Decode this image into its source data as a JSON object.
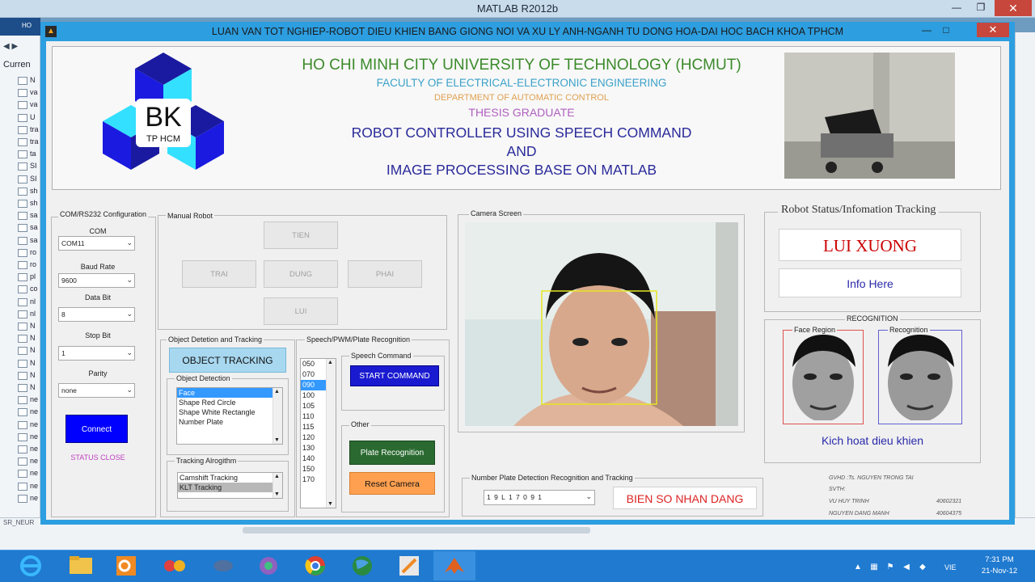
{
  "matlab": {
    "title": "MATLAB R2012b",
    "side_header": "HO",
    "side_current": "Curren",
    "side_items": [
      "N",
      "va",
      "va",
      "U",
      "tra",
      "tra",
      "ta",
      "SI",
      "SI",
      "sh",
      "sh",
      "sa",
      "sa",
      "sa",
      "ro",
      "ro",
      "pl",
      "co",
      "nl",
      "nl",
      "N",
      "N",
      "N",
      "N",
      "N",
      "N",
      "ne",
      "ne",
      "ne",
      "ne",
      "ne",
      "ne",
      "ne",
      "ne",
      "ne"
    ],
    "status": "SR_NEUR"
  },
  "gui": {
    "title": "LUAN VAN TOT NGHIEP-ROBOT DIEU KHIEN BANG GIONG NOI VA XU LY ANH-NGANH TU DONG HOA-DAI HOC BACH KHOA TPHCM",
    "window_controls": {
      "minimize": "—",
      "maximize": "□",
      "close": "✕"
    }
  },
  "header": {
    "logo_text": "BK",
    "logo_sub": "TP HCM",
    "university": "HO CHI MINH CITY UNIVERSITY OF TECHNOLOGY (HCMUT)",
    "faculty": "FACULTY OF ELECTRICAL-ELECTRONIC ENGINEERING",
    "department": "DEPARTMENT OF AUTOMATIC CONTROL",
    "thesis": "THESIS GRADUATE",
    "title_line1": "ROBOT CONTROLLER USING SPEECH COMMAND",
    "title_line2": "AND",
    "title_line3": "IMAGE PROCESSING BASE ON MATLAB"
  },
  "com_panel": {
    "title": "COM/RS232 Configuration",
    "com_label": "COM",
    "com_value": "COM11",
    "baud_label": "Baud Rate",
    "baud_value": "9600",
    "databit_label": "Data Bit",
    "databit_value": "8",
    "stopbit_label": "Stop Bit",
    "stopbit_value": "1",
    "parity_label": "Parity",
    "parity_value": "none",
    "connect_label": "Connect",
    "status": "STATUS CLOSE"
  },
  "manual_panel": {
    "title": "Manual Robot",
    "up": "TIEN",
    "left": "TRAI",
    "stop": "DUNG",
    "right": "PHAI",
    "down": "LUI"
  },
  "object_panel": {
    "title": "Object Detetion and Tracking",
    "tracking_button": "OBJECT TRACKING",
    "detection_title": "Object Detection",
    "detection_items": [
      "Face",
      "Shape Red Circle",
      "Shape White Rectangle",
      "Number Plate"
    ],
    "tracking_title": "Tracking Alrogithm",
    "tracking_items": [
      "Camshift Tracking",
      "KLT Tracking"
    ]
  },
  "speech_panel": {
    "title": "Speech/PWM/Plate Recognition",
    "pwm_items": [
      "050",
      "070",
      "090",
      "100",
      "105",
      "110",
      "115",
      "120",
      "130",
      "140",
      "150",
      "170"
    ],
    "speech_title": "Speech Command",
    "start_command": "START COMMAND",
    "other_title": "Other",
    "plate_button": "Plate Recognition",
    "reset_button": "Reset Camera"
  },
  "camera_panel": {
    "title": "Camera Screen"
  },
  "plate_panel": {
    "title": "Number Plate Detection Recognition and Tracking",
    "plate_value": "1 9 L 1 7 0 9 1",
    "plate_result": "BIEN SO NHAN DANG"
  },
  "status_panel": {
    "title": "Robot Status/Infomation Tracking",
    "status_text": "LUI XUONG",
    "info_text": "Info Here"
  },
  "recognition_panel": {
    "title": "RECOGNITION",
    "face_title": "Face Region",
    "recog_title": "Recognition",
    "action": "Kich hoat dieu khien"
  },
  "credits": {
    "advisor": "GVHD :Ts. NGUYEN TRONG TAI",
    "sv_label": "SVTH:",
    "student1_name": "VU HUY TRINH",
    "student1_id": "40602321",
    "student2_name": "NGUYEN DANG MANH",
    "student2_id": "40604375"
  },
  "taskbar": {
    "lang": "VIE",
    "time": "7:31 PM",
    "date": "21-Nov-12"
  },
  "colors": {
    "accent_blue": "#2d9ee0",
    "connect_blue": "#0000ff",
    "status_red": "#cc0000"
  }
}
